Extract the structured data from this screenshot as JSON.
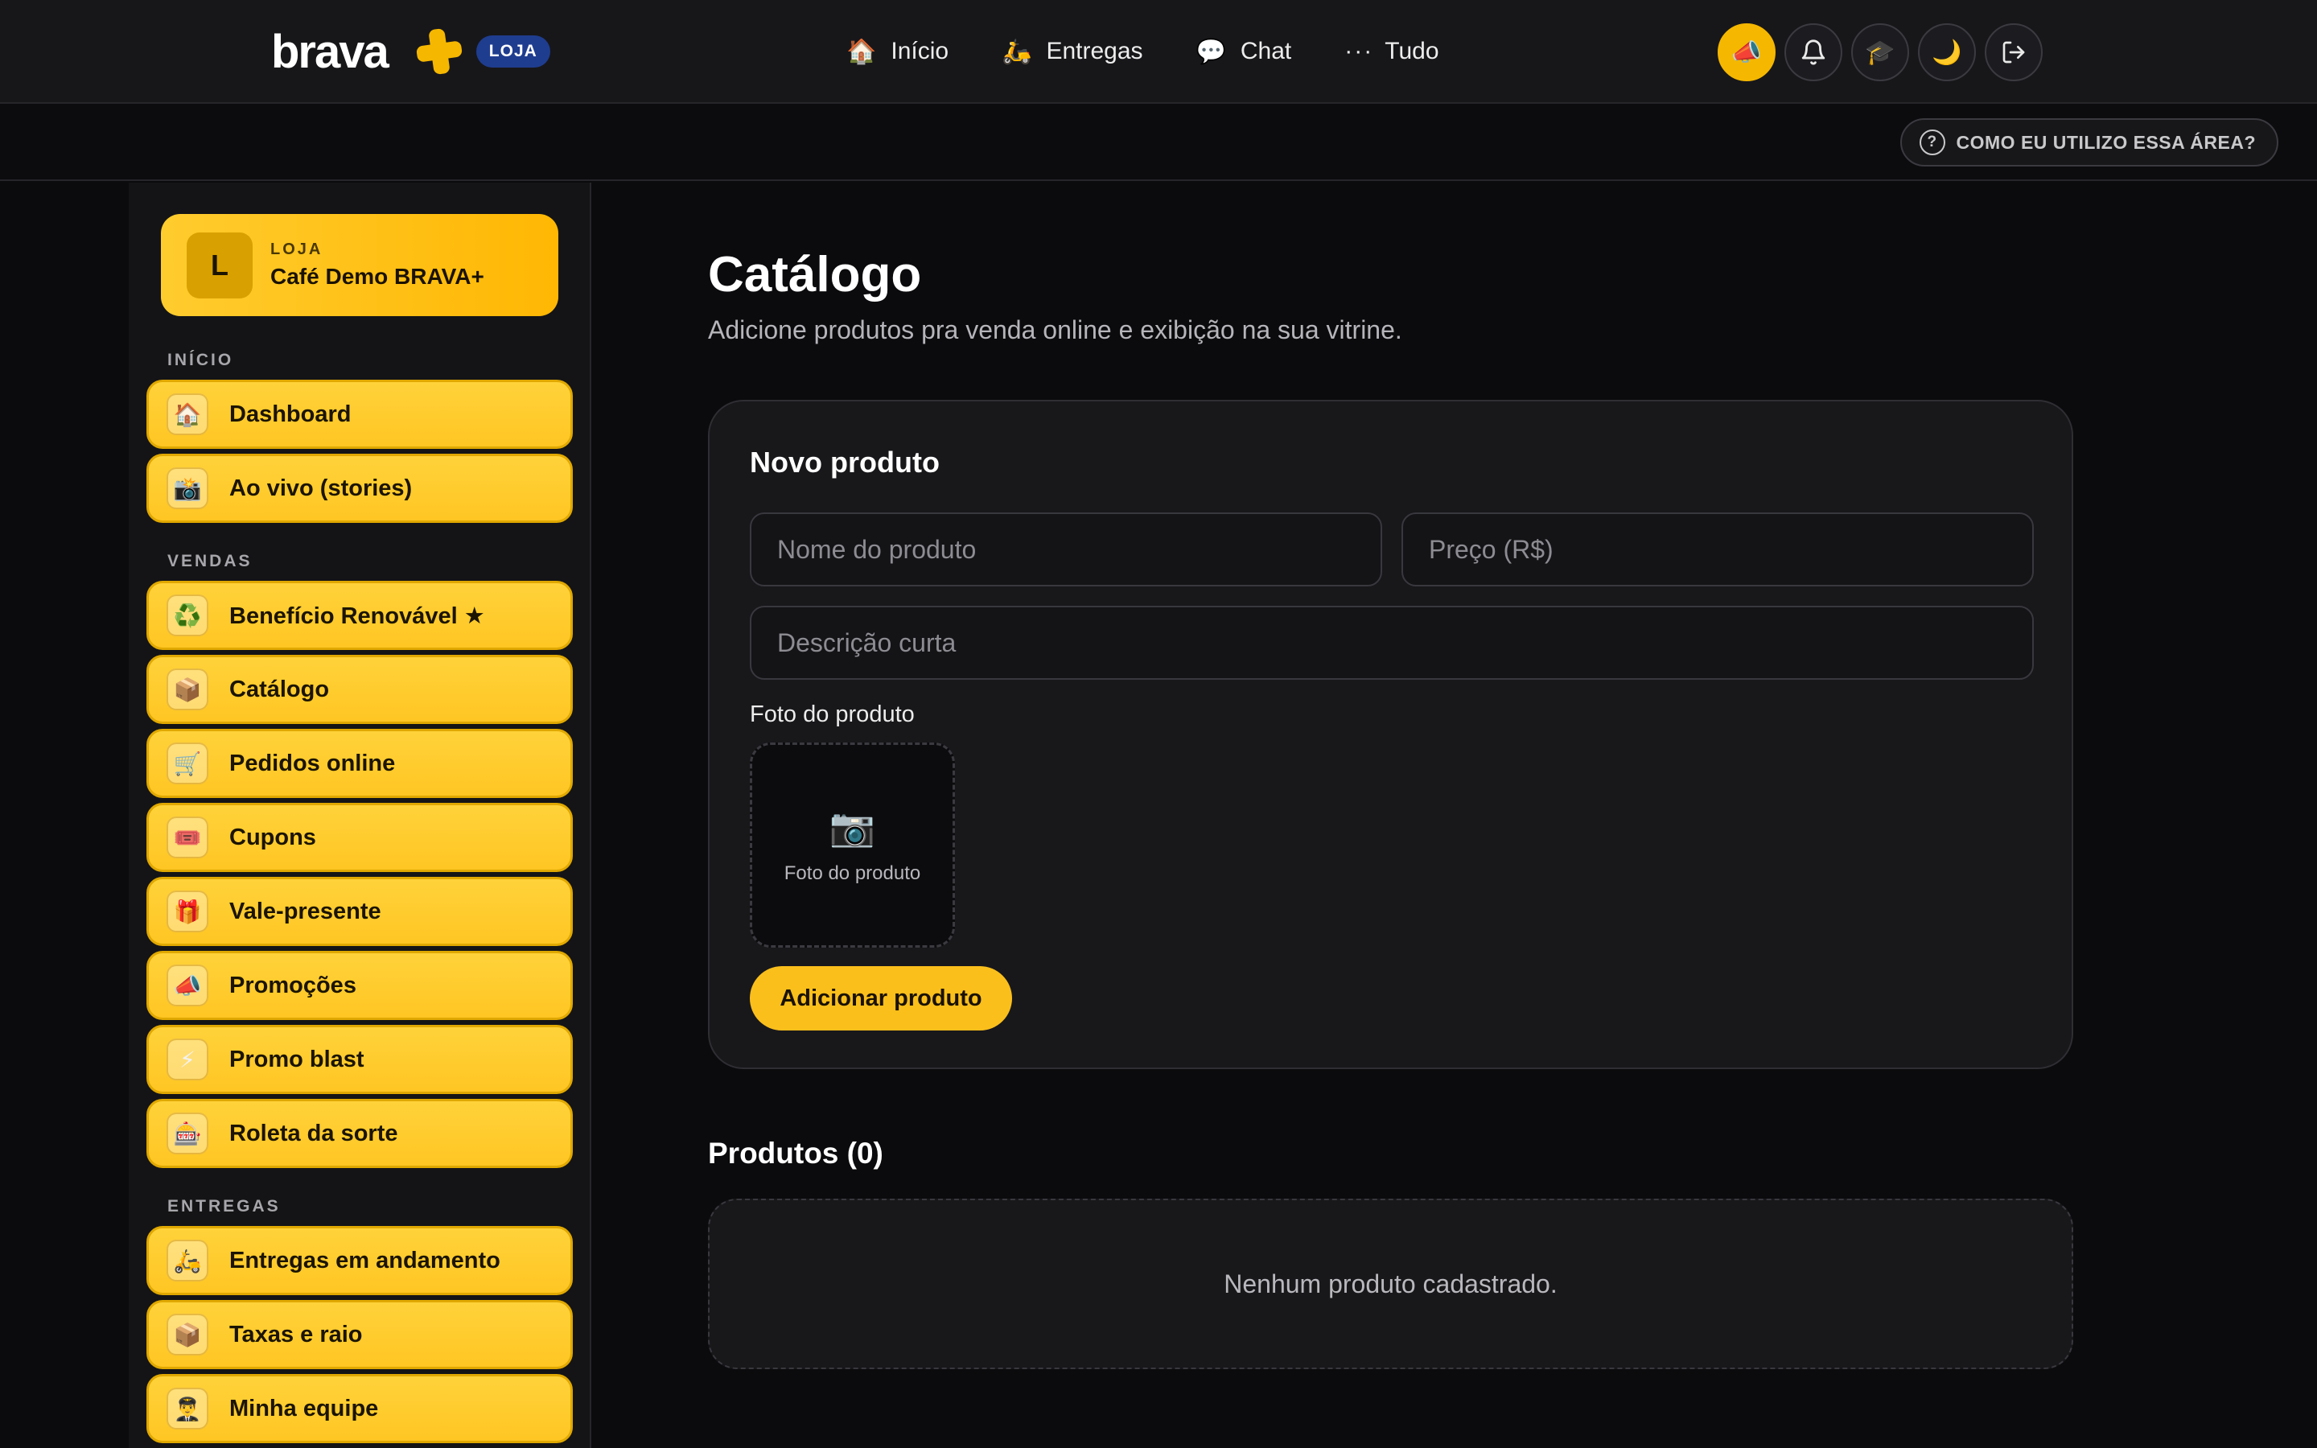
{
  "brand": {
    "wordmark": "brava",
    "badge": "LOJA"
  },
  "nav": {
    "links": [
      {
        "icon": "🏠",
        "label": "Início"
      },
      {
        "icon": "🛵",
        "label": "Entregas"
      },
      {
        "icon": "💬",
        "label": "Chat"
      },
      {
        "icon": "···",
        "label": "Tudo"
      }
    ],
    "actions": {
      "promo_icon": "📣",
      "bell_icon": "🔔",
      "learn_icon": "🎓",
      "theme_icon": "🌙",
      "logout_icon": "⇥"
    }
  },
  "subbar": {
    "help_icon": "?",
    "help_label": "COMO EU UTILIZO ESSA ÁREA?"
  },
  "sidebar": {
    "store": {
      "avatar": "L",
      "kicker": "LOJA",
      "name": "Café Demo BRAVA+"
    },
    "sections": [
      {
        "label": "INÍCIO"
      },
      {
        "label": "VENDAS"
      },
      {
        "label": "ENTREGAS"
      }
    ],
    "items": [
      {
        "icon": "🏠",
        "label": "Dashboard"
      },
      {
        "icon": "📸",
        "label": "Ao vivo (stories)"
      },
      {
        "icon": "♻️",
        "label": "Benefício Renovável ★"
      },
      {
        "icon": "📦",
        "label": "Catálogo"
      },
      {
        "icon": "🛒",
        "label": "Pedidos online"
      },
      {
        "icon": "🎟️",
        "label": "Cupons"
      },
      {
        "icon": "🎁",
        "label": "Vale-presente"
      },
      {
        "icon": "📣",
        "label": "Promoções"
      },
      {
        "icon": "⚡",
        "label": "Promo blast"
      },
      {
        "icon": "🎰",
        "label": "Roleta da sorte"
      },
      {
        "icon": "🛵",
        "label": "Entregas em andamento"
      },
      {
        "icon": "📦",
        "label": "Taxas e raio"
      },
      {
        "icon": "👨‍✈️",
        "label": "Minha equipe"
      }
    ]
  },
  "main": {
    "title": "Catálogo",
    "subtitle": "Adicione produtos pra venda online e exibição na sua vitrine.",
    "form": {
      "title": "Novo produto",
      "name_placeholder": "Nome do produto",
      "price_placeholder": "Preço (R$)",
      "desc_placeholder": "Descrição curta",
      "photo_label": "Foto do produto",
      "photo_icon": "📷",
      "photo_hint": "Foto do produto",
      "submit_label": "Adicionar produto"
    },
    "products": {
      "title": "Produtos (0)",
      "empty": "Nenhum produto cadastrado."
    }
  }
}
